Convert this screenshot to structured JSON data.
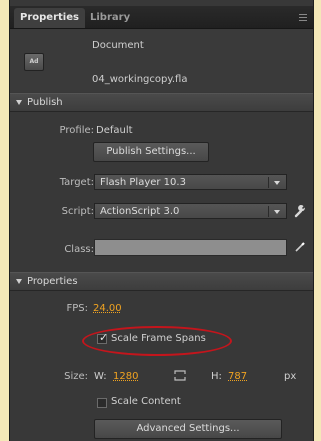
{
  "tabs": [
    {
      "label": "Properties",
      "active": true
    },
    {
      "label": "Library",
      "active": false
    }
  ],
  "document": {
    "icon_text": "Ad",
    "type_label": "Document",
    "file_name": "04_workingcopy.fla"
  },
  "publish": {
    "header": "Publish",
    "profile_label": "Profile:",
    "profile_value": "Default",
    "publish_settings_button": "Publish Settings...",
    "target_label": "Target:",
    "target_value": "Flash Player 10.3",
    "script_label": "Script:",
    "script_value": "ActionScript 3.0",
    "class_label": "Class:",
    "class_value": ""
  },
  "properties": {
    "header": "Properties",
    "fps_label": "FPS:",
    "fps_value": "24.00",
    "scale_frame_spans_label": "Scale Frame Spans",
    "scale_frame_spans_checked": true,
    "size_label": "Size:",
    "width_label": "W:",
    "width_value": "1280",
    "height_label": "H:",
    "height_value": "787",
    "unit": "px",
    "scale_content_label": "Scale Content",
    "scale_content_checked": false,
    "advanced_settings_button": "Advanced Settings..."
  },
  "colors": {
    "accent_orange": "#f0a321",
    "highlight_red": "#c4151c",
    "panel_bg": "#383838"
  }
}
